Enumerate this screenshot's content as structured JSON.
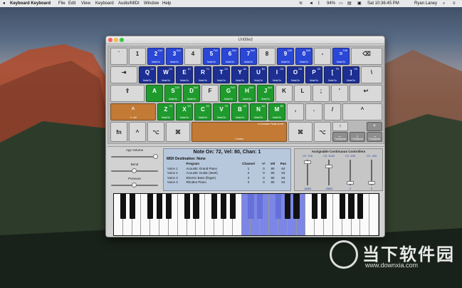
{
  "menubar": {
    "app": "Keyboard Keyboard",
    "items": [
      "File",
      "Edit",
      "View",
      "Keyboard",
      "Audio/MIDI",
      "Window",
      "Help"
    ],
    "battery": "94%",
    "datetime": "Sat 10:36:45 PM",
    "user": "Ryan Laney"
  },
  "window": {
    "title": "Untitled"
  },
  "keys": {
    "backtick": "`",
    "k1": "1",
    "k2": "2",
    "k3": "3",
    "k4": "4",
    "k5": "5",
    "k6": "6",
    "k7": "7",
    "k8": "8",
    "k9": "9",
    "k0": "0",
    "minus": "-",
    "equal": "=",
    "q": "Q",
    "w": "W",
    "e": "E",
    "r": "R",
    "t": "T",
    "y": "Y",
    "u": "U",
    "i": "I",
    "o": "O",
    "p": "P",
    "lbr": "[",
    "rbr": "]",
    "a": "A",
    "s": "S",
    "d": "D",
    "f": "F",
    "g": "G",
    "h": "H",
    "j": "J",
    "k": "K",
    "l": "L",
    "semi": ";",
    "quote": "'",
    "z": "Z",
    "x": "X",
    "c": "C",
    "v": "V",
    "b": "B",
    "n": "N",
    "m": "M",
    "comma": ",",
    "period": ".",
    "slash": "/",
    "fn": "fn",
    "ctrl": "^",
    "opt": "⌥",
    "cmd": "⌘",
    "cmd2": "⌘",
    "opt2": "⌥",
    "tab": "⇥",
    "caps": "⇪",
    "shift": "^",
    "shiftsub": "+/- Vel",
    "delete": "⌫",
    "return": "↩",
    "up": "↑",
    "down": "↓",
    "left": "←",
    "right": "→",
    "noteon": "NoteOn",
    "sustain": "x4 Sustain Pedal on/off",
    "space_sub": "Control",
    "transpose": "Transpose",
    "transpose_minus": "−",
    "transpose_plus": "+",
    "octave_up": "+Oct",
    "octave_down": "−Oct"
  },
  "note_labels": {
    "k2": "C♯4",
    "k3": "D♯4",
    "k5": "F♯4",
    "k6": "G♯4",
    "k7": "A♯4",
    "k9": "C♯5",
    "k0": "D♯5",
    "equal": "F♯5",
    "q": "C4",
    "w": "D4",
    "e": "E4",
    "r": "F4",
    "t": "G4",
    "y": "A4",
    "u": "B4",
    "i": "C5",
    "o": "D5",
    "p": "E5",
    "lbr": "F5",
    "rbr": "G5",
    "s": "C♯3",
    "d": "D♯3",
    "g": "F♯3",
    "h": "G♯3",
    "j": "A♯3",
    "z": "C3",
    "x": "D3",
    "c": "E3",
    "v": "F3",
    "b": "G3",
    "n": "A3",
    "m": "B3"
  },
  "sliders": [
    {
      "label": "App Volume",
      "value": 0.96
    },
    {
      "label": "Bend",
      "value": 0.5
    },
    {
      "label": "Pressure",
      "value": 0.5
    }
  ],
  "info": {
    "header": "Note On: 72, Vel: 80, Chan: 1",
    "dest": "MIDI Destination: None",
    "columns": [
      "",
      "Program",
      "Channel",
      "+/-",
      "Vel",
      "Pan"
    ],
    "voices": [
      {
        "v": "Voice 1",
        "program": "Acoustic Grand Piano",
        "ch": "1",
        "pm": "0",
        "vel": "80",
        "pan": "64"
      },
      {
        "v": "Voice 2",
        "program": "Acoustic Guitar (steel)",
        "ch": "2",
        "pm": "0",
        "vel": "80",
        "pan": "64"
      },
      {
        "v": "Voice 3",
        "program": "Electric Bass (finger)",
        "ch": "3",
        "pm": "0",
        "vel": "80",
        "pan": "64"
      },
      {
        "v": "Voice 4",
        "program": "Rhodes Piano",
        "ch": "4",
        "pm": "0",
        "vel": "80",
        "pan": "64"
      }
    ]
  },
  "cc": {
    "title": "Assignable Continuous Controllers",
    "items": [
      {
        "label": "CC: 7/16",
        "value": "16383",
        "level": 0.98
      },
      {
        "label": "CC: 11/43",
        "value": "12800",
        "level": 0.78
      },
      {
        "label": "CC: 1/33",
        "value": "0",
        "level": 0.02
      },
      {
        "label": "CC: 1/33",
        "value": "0",
        "level": 0.02
      }
    ]
  },
  "piano": {
    "white_count": 29,
    "white_on": [
      14,
      15,
      16,
      17,
      18,
      19,
      20
    ],
    "black_on": [
      10,
      11,
      12
    ]
  },
  "watermark": {
    "cn": "当下软件园",
    "url": "www.downxia.com"
  },
  "colors": {
    "blue": "#1d2f93",
    "green": "#1f9b2e",
    "brown": "#c27a35",
    "highlight": "#7b86e6"
  }
}
